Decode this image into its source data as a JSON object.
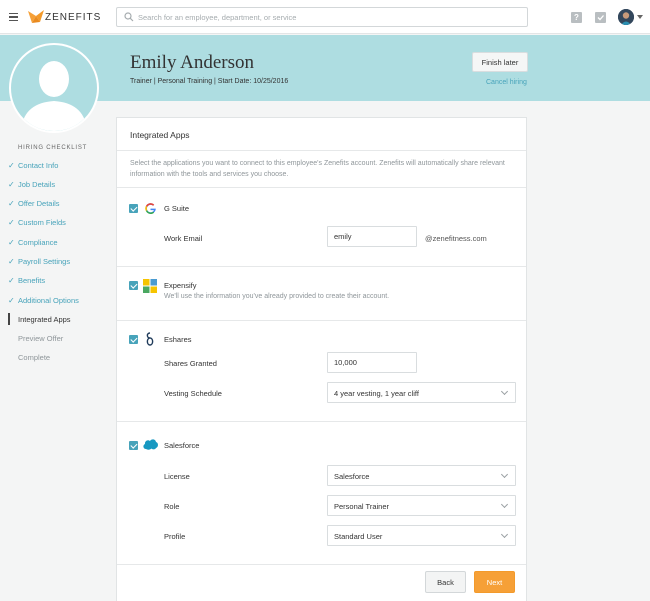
{
  "app": {
    "brand": "ZENEFITS",
    "accent": "#47a3ba",
    "hero_color": "#aedde1",
    "primary_button_color": "#f6a037"
  },
  "topbar": {
    "search_placeholder": "Search for an employee, department, or service",
    "icons": [
      "menu-icon",
      "search-icon",
      "help-icon",
      "tasks-icon",
      "avatar"
    ]
  },
  "employee": {
    "name": "Emily Anderson",
    "subtitle": "Trainer | Personal Training | Start Date: 10/25/2016"
  },
  "header_actions": {
    "finish_later": "Finish later",
    "cancel_hiring": "Cancel hiring"
  },
  "checklist": {
    "title": "HIRING CHECKLIST",
    "items": [
      {
        "label": "Contact Info",
        "state": "done"
      },
      {
        "label": "Job Details",
        "state": "done"
      },
      {
        "label": "Offer Details",
        "state": "done"
      },
      {
        "label": "Custom Fields",
        "state": "done"
      },
      {
        "label": "Compliance",
        "state": "done"
      },
      {
        "label": "Payroll Settings",
        "state": "done"
      },
      {
        "label": "Benefits",
        "state": "done"
      },
      {
        "label": "Additional Options",
        "state": "done"
      },
      {
        "label": "Integrated Apps",
        "state": "active"
      },
      {
        "label": "Preview Offer",
        "state": "todo"
      },
      {
        "label": "Complete",
        "state": "todo"
      }
    ]
  },
  "card": {
    "title": "Integrated Apps",
    "description": "Select the applications you want to connect to this employee's Zenefits account. Zenefits will automatically share relevant information with the tools and services you choose."
  },
  "apps": {
    "gsuite": {
      "name": "G Suite",
      "checked": true,
      "email_label": "Work Email",
      "email_value": "emily",
      "email_suffix": "@zenefitness.com"
    },
    "expensify": {
      "name": "Expensify",
      "checked": true,
      "helper": "We'll use the information you've already provided to create their account."
    },
    "eshares": {
      "name": "Eshares",
      "checked": true,
      "shares_label": "Shares Granted",
      "shares_value": "10,000",
      "vesting_label": "Vesting Schedule",
      "vesting_value": "4 year vesting, 1 year cliff"
    },
    "salesforce": {
      "name": "Salesforce",
      "checked": true,
      "license_label": "License",
      "license_value": "Salesforce",
      "role_label": "Role",
      "role_value": "Personal Trainer",
      "profile_label": "Profile",
      "profile_value": "Standard User"
    }
  },
  "footer": {
    "back": "Back",
    "next": "Next"
  }
}
